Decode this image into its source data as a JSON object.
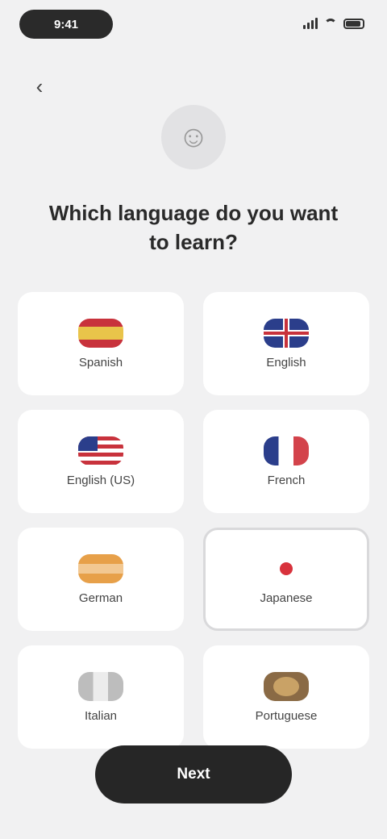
{
  "status_bar": {
    "time": "9:41"
  },
  "header": {
    "title": "Which language do you want to learn?"
  },
  "languages": [
    {
      "label": "Spanish",
      "flag": "es",
      "selected": false
    },
    {
      "label": "English",
      "flag": "uk",
      "selected": false
    },
    {
      "label": "English (US)",
      "flag": "us",
      "selected": false
    },
    {
      "label": "French",
      "flag": "fr",
      "selected": false
    },
    {
      "label": "German",
      "flag": "de",
      "selected": false
    },
    {
      "label": "Japanese",
      "flag": "jp",
      "selected": true
    },
    {
      "label": "Italian",
      "flag": "it",
      "selected": false
    },
    {
      "label": "Portuguese",
      "flag": "br",
      "selected": false
    }
  ],
  "footer": {
    "continue_label": "Next"
  },
  "colors": {
    "background": "#f1f1f2",
    "card": "#ffffff",
    "primary_button": "#262626",
    "selected_border": "#d9d9db"
  }
}
